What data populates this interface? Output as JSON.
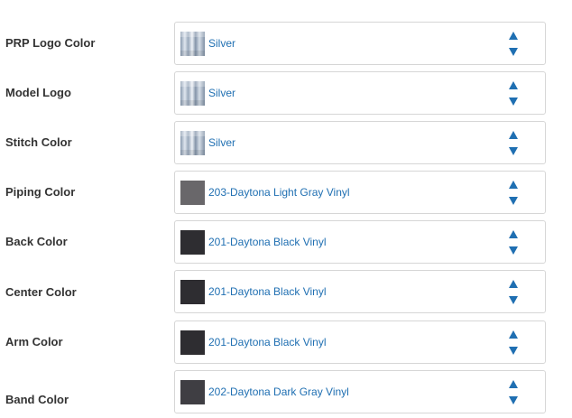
{
  "colors": {
    "label_text": "#333333",
    "value_text": "#1f6fb2",
    "arrow": "#1f6fb2",
    "border": "#d6d6d6"
  },
  "options": [
    {
      "label": "PRP Logo Color",
      "value": "Silver",
      "swatch": "silver",
      "icon": "sort-arrows-icon"
    },
    {
      "label": "Model Logo",
      "value": "Silver",
      "swatch": "silver",
      "icon": "sort-arrows-icon"
    },
    {
      "label": "Stitch Color",
      "value": "Silver",
      "swatch": "silver",
      "icon": "sort-arrows-icon"
    },
    {
      "label": "Piping Color",
      "value": "203-Daytona Light Gray Vinyl",
      "swatch": "#69676a",
      "icon": "sort-arrows-icon"
    },
    {
      "label": "Back Color",
      "value": "201-Daytona Black Vinyl",
      "swatch": "#2e2d31",
      "icon": "sort-arrows-icon"
    },
    {
      "label": "Center Color",
      "value": "201-Daytona Black Vinyl",
      "swatch": "#2e2d31",
      "icon": "sort-arrows-icon"
    },
    {
      "label": "Arm Color",
      "value": "201-Daytona Black Vinyl",
      "swatch": "#2e2d31",
      "icon": "sort-arrows-icon"
    },
    {
      "label": "Band Color",
      "value": "202-Daytona Dark Gray Vinyl",
      "swatch": "#3f3e43",
      "icon": "sort-arrows-icon"
    }
  ]
}
